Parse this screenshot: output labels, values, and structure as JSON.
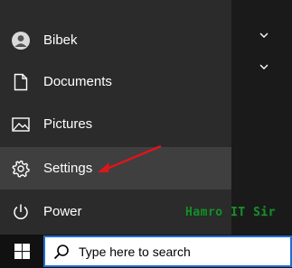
{
  "start_menu": {
    "items": [
      {
        "label": "Bibek",
        "icon": "user-icon"
      },
      {
        "label": "Documents",
        "icon": "document-icon"
      },
      {
        "label": "Pictures",
        "icon": "picture-icon"
      },
      {
        "label": "Settings",
        "icon": "gear-icon",
        "active": true
      },
      {
        "label": "Power",
        "icon": "power-icon"
      }
    ]
  },
  "taskbar": {
    "search_placeholder": "Type here to search",
    "start_icon": "windows-logo-icon",
    "search_icon": "search-icon"
  },
  "watermark": "Hamro IT Sir",
  "colors": {
    "menu_bg": "#2b2b2b",
    "active_bg": "#3f3f3f",
    "taskbar_bg": "#111111",
    "arrow": "#e0141a",
    "watermark": "#1e8a2e"
  }
}
